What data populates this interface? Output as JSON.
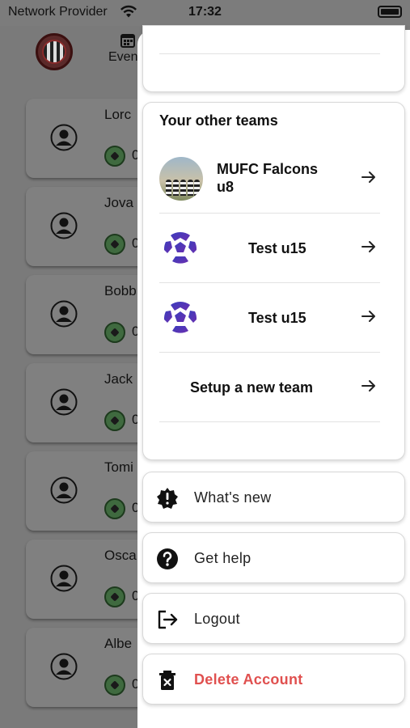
{
  "status_bar": {
    "provider": "Network Provider",
    "time": "17:32"
  },
  "background": {
    "events_tab_label": "Even",
    "players": [
      {
        "name": "Lorc",
        "count": "0"
      },
      {
        "name": "Jova",
        "count": "0"
      },
      {
        "name": "Bobb",
        "count": "0"
      },
      {
        "name": "Jack",
        "count": "0"
      },
      {
        "name": "Tomi",
        "count": "0"
      },
      {
        "name": "Osca",
        "count": "0"
      },
      {
        "name": "Albe",
        "count": "0"
      }
    ]
  },
  "drawer": {
    "teams_heading": "Your other teams",
    "teams": [
      {
        "line1": "MUFC Falcons",
        "line2": "u8",
        "icon": "team-photo"
      },
      {
        "line1": "Test u15",
        "icon": "soccer-ball-icon"
      },
      {
        "line1": "Test u15",
        "icon": "soccer-ball-icon"
      }
    ],
    "setup_label": "Setup a new team",
    "menu": {
      "whats_new": "What's new",
      "get_help": "Get help",
      "logout": "Logout",
      "delete_account": "Delete Account"
    }
  },
  "colors": {
    "danger": "#e0504f",
    "ball_blue": "#3b3dbd",
    "ball_purple": "#6b2fb0",
    "overlay": "#7a7a7a"
  }
}
